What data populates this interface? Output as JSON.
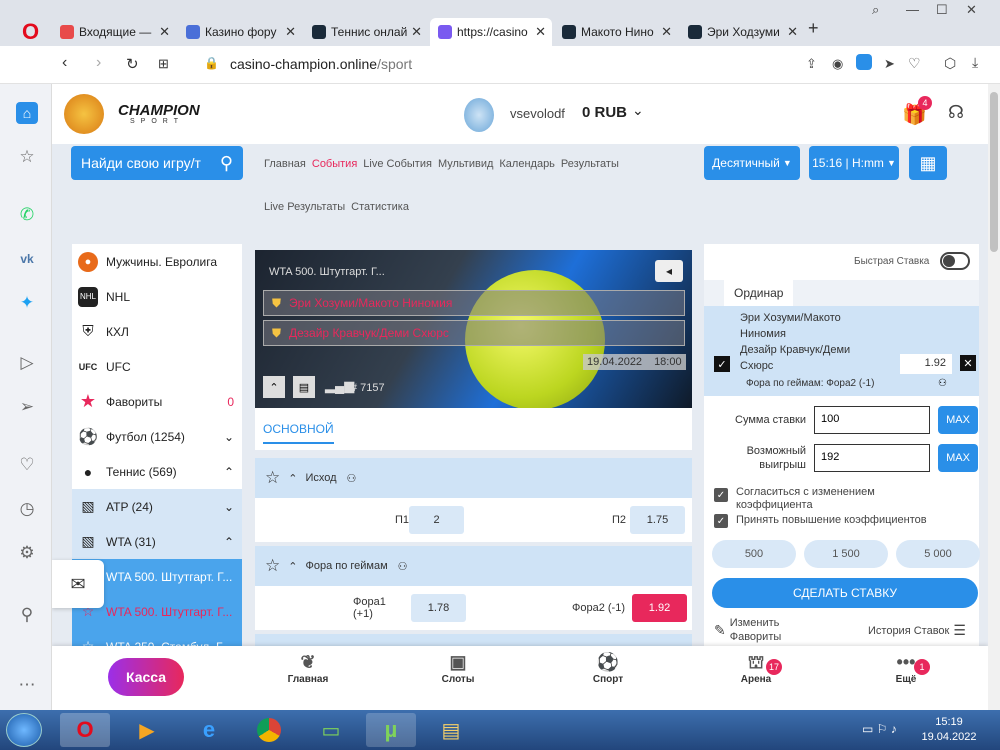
{
  "browser": {
    "tabs": [
      {
        "label": "Входящие — ",
        "color": "#e84a4a"
      },
      {
        "label": "Казино фору",
        "color": "#4a6fd8"
      },
      {
        "label": "Теннис онлай",
        "color": "#1a2a3a"
      },
      {
        "label": "https://casino",
        "color": "#7a5af0"
      },
      {
        "label": "Макото Нино",
        "color": "#1a2a3a"
      },
      {
        "label": "Эри Ходзуми",
        "color": "#1a2a3a"
      }
    ],
    "url_domain": "casino-champion.online",
    "url_path": "/sport"
  },
  "header": {
    "brand": "CHAMPION",
    "brand_sub": "SPORT",
    "username": "vsevolodf",
    "balance": "0 RUB",
    "gift_badge": "4"
  },
  "search": {
    "placeholder": "Найди свою игру/т"
  },
  "nav": {
    "items": [
      "Главная",
      "События",
      "Live События",
      "Мультивид",
      "Календарь",
      "Результаты"
    ],
    "items2": [
      "Live Результаты",
      "Статистика"
    ],
    "active_color": "#e8285c"
  },
  "controls": {
    "odds_format": "Десятичный",
    "time": "15:16 | H:mm"
  },
  "left_menu": [
    {
      "icon": "euroleague-icon",
      "label": "Мужчины. Евролига"
    },
    {
      "icon": "nhl-icon",
      "label": "NHL"
    },
    {
      "icon": "khl-icon",
      "label": "КХЛ"
    },
    {
      "icon": "ufc-icon",
      "label": "UFC"
    },
    {
      "icon": "star-icon",
      "label": "Фавориты",
      "count": "0"
    },
    {
      "icon": "football-icon",
      "label": "Футбол (1254)"
    },
    {
      "icon": "tennis-icon",
      "label": "Теннис (569)"
    },
    {
      "icon": "map-icon",
      "label": "ATP (24)"
    },
    {
      "icon": "map-icon",
      "label": "WTA (31)"
    },
    {
      "icon": "star-icon",
      "label": "WTA 500. Штутгарт. Г..."
    },
    {
      "icon": "star-icon",
      "label": "WTA 500. Штутгарт. Г..."
    },
    {
      "icon": "star-icon",
      "label": "WTA 250. Стамбул. Г..."
    }
  ],
  "event": {
    "tournament": "WTA 500. Штутгарт. Г...",
    "team1": "Эри Хозуми/Макото Ниномия",
    "team2": "Дезайр Кравчук/Деми Схюрс",
    "date": "19.04.2022",
    "time": "18:00",
    "id": "# 7157",
    "tab": "ОСНОВНОЙ"
  },
  "markets": [
    {
      "title": "Исход",
      "l1": "П1",
      "o1": "2",
      "l2": "П2",
      "o2": "1.75"
    },
    {
      "title": "Фора по геймам",
      "l1": "Фора1 (+1)",
      "o1": "1.78",
      "l2": "Фора2 (-1)",
      "o2": "1.92"
    }
  ],
  "betslip": {
    "quick_bet": "Быстрая Ставка",
    "tab": "Ординар",
    "match_line1": "Эри Хозуми/Макото",
    "match_line2": "Ниномия",
    "match_line3": "Дезайр Кравчук/Деми",
    "match_line4": "Схюрс",
    "odd": "1.92",
    "market": "Фора по геймам: Фора2 (-1)",
    "stake_label": "Сумма ставки",
    "stake_value": "100",
    "win_label1": "Возможный",
    "win_label2": "выигрыш",
    "win_value": "192",
    "max": "MAX",
    "agree1": "Согласиться с изменением",
    "agree2": "коэффициента",
    "accept": "Принять повышение коэффициентов",
    "quick_amounts": [
      "500",
      "1 500",
      "5 000"
    ],
    "submit": "СДЕЛАТЬ СТАВКУ",
    "edit_fav1": "Изменить",
    "edit_fav2": "Фавориты",
    "history": "История Ставок"
  },
  "bottom_nav": {
    "cash": "Касса",
    "items": [
      {
        "label": "Главная",
        "icon": "laurel-icon"
      },
      {
        "label": "Слоты",
        "icon": "slot-icon"
      },
      {
        "label": "Спорт",
        "icon": "ball-icon"
      },
      {
        "label": "Арена",
        "icon": "arena-icon",
        "badge": "17"
      },
      {
        "label": "Ещё",
        "icon": "more-icon",
        "badge": "1"
      }
    ]
  },
  "taskbar": {
    "time": "15:19",
    "date": "19.04.2022"
  }
}
